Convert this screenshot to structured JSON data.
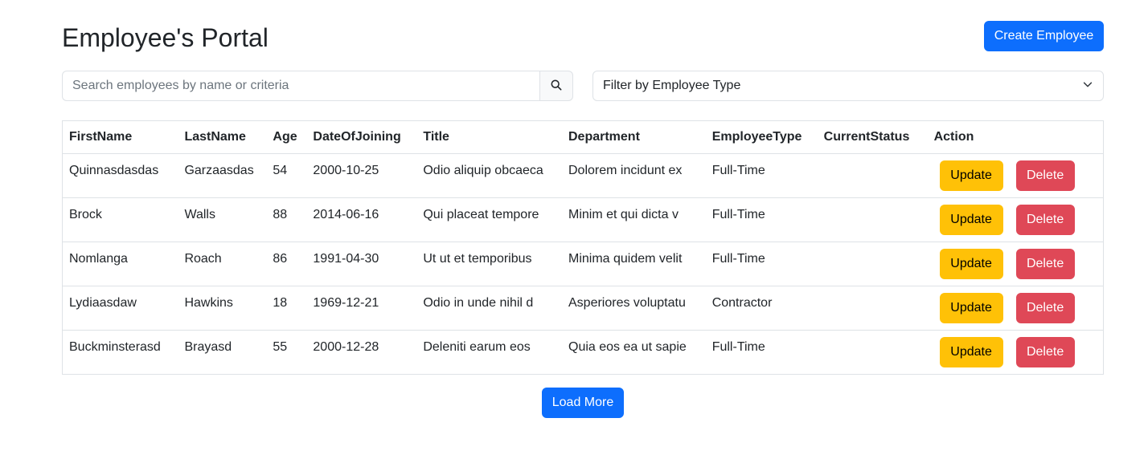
{
  "header": {
    "title": "Employee's Portal",
    "create_label": "Create Employee"
  },
  "search": {
    "placeholder": "Search employees by name or criteria",
    "icon": "search-icon"
  },
  "filter": {
    "selected": "Filter by Employee Type",
    "icon": "chevron-down-icon"
  },
  "table": {
    "headers": [
      "FirstName",
      "LastName",
      "Age",
      "DateOfJoining",
      "Title",
      "Department",
      "EmployeeType",
      "CurrentStatus",
      "Action"
    ],
    "rows": [
      [
        "Quinnasdasdas",
        "Garzaasdas",
        "54",
        "2000-10-25",
        "Odio aliquip obcaeca",
        "Dolorem incidunt ex",
        "Full-Time",
        ""
      ],
      [
        "Brock",
        "Walls",
        "88",
        "2014-06-16",
        "Qui placeat tempore",
        "Minim et qui dicta v",
        "Full-Time",
        ""
      ],
      [
        "Nomlanga",
        "Roach",
        "86",
        "1991-04-30",
        "Ut ut et temporibus",
        "Minima quidem velit",
        "Full-Time",
        ""
      ],
      [
        "Lydiaasdaw",
        "Hawkins",
        "18",
        "1969-12-21",
        "Odio in unde nihil d",
        "Asperiores voluptatu",
        "Contractor",
        ""
      ],
      [
        "Buckminsterasd",
        "Brayasd",
        "55",
        "2000-12-28",
        "Deleniti earum eos",
        "Quia eos ea ut sapie",
        "Full-Time",
        ""
      ]
    ],
    "update_label": "Update",
    "delete_label": "Delete"
  },
  "footer": {
    "load_more_label": "Load More"
  },
  "colors": {
    "primary": "#0d6efd",
    "warning": "#ffc107",
    "danger": "#dc3545"
  }
}
